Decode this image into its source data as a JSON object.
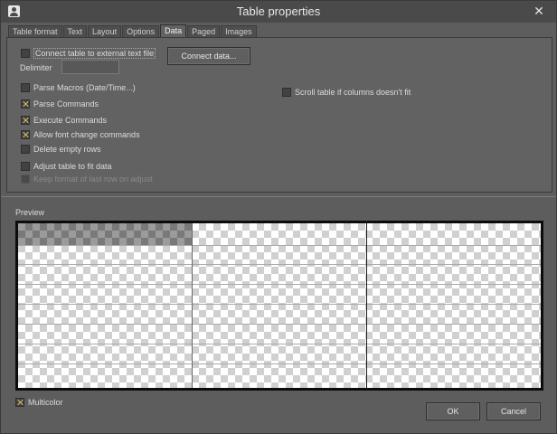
{
  "window": {
    "title": "Table properties",
    "close_glyph": "✕"
  },
  "tabs": [
    {
      "label": "Table format",
      "active": false
    },
    {
      "label": "Text",
      "active": false
    },
    {
      "label": "Layout",
      "active": false
    },
    {
      "label": "Options",
      "active": false
    },
    {
      "label": "Data",
      "active": true
    },
    {
      "label": "Paged",
      "active": false
    },
    {
      "label": "Images",
      "active": false
    }
  ],
  "data_tab": {
    "connect_external_label": "Connect table to external text file",
    "connect_external_checked": false,
    "delimiter_label": "Delimiter",
    "delimiter_value": "",
    "connect_data_button": "Connect data...",
    "parse_macros_label": "Parse Macros (Date/Time...)",
    "parse_macros_checked": false,
    "parse_commands_label": "Parse Commands",
    "parse_commands_checked": true,
    "execute_commands_label": "Execute Commands",
    "execute_commands_checked": true,
    "allow_font_change_label": "Allow font change commands",
    "allow_font_change_checked": true,
    "delete_empty_rows_label": "Delete empty rows",
    "delete_empty_rows_checked": false,
    "adjust_table_label": "Adjust table to fit data",
    "adjust_table_checked": false,
    "keep_format_label": "Keep format of last row on adjust",
    "keep_format_checked": false,
    "scroll_table_label": "Scroll table if columns doesn't fit",
    "scroll_table_checked": false
  },
  "preview": {
    "label": "Preview"
  },
  "footer": {
    "multicolor_label": "Multicolor",
    "multicolor_checked": true,
    "ok_button": "OK",
    "cancel_button": "Cancel"
  },
  "colors": {
    "background": "#5d5d5d",
    "panel": "#626262",
    "titlebar": "#4a4a4a",
    "check_mark": "#e8c86a"
  }
}
